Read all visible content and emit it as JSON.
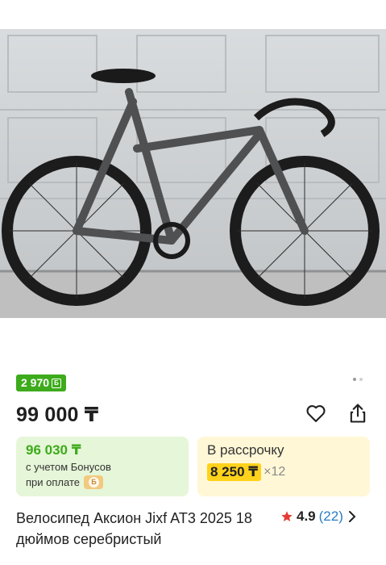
{
  "product": {
    "bonus_badge": "2 970",
    "bonus_badge_icon": "bonus-b-icon",
    "price": "99 000 ₸",
    "bonus_price": "96 030 ₸",
    "bonus_line1": "с учетом Бонусов",
    "bonus_line2": "при оплате",
    "installment_title": "В рассрочку",
    "installment_price": "8 250 ₸",
    "installment_times": "×12",
    "title": "Велосипед Аксион Jixf AT3 2025 18 дюймов серебристый",
    "rating": "4.9",
    "reviews": "(22)"
  },
  "colors": {
    "bonus_green": "#3dab1b",
    "installment_yellow": "#ffd21c",
    "star": "#e43d35",
    "review_link": "#2a7cc7"
  },
  "icons": [
    "heart-icon",
    "share-icon",
    "star-icon",
    "chevron-right-icon"
  ]
}
